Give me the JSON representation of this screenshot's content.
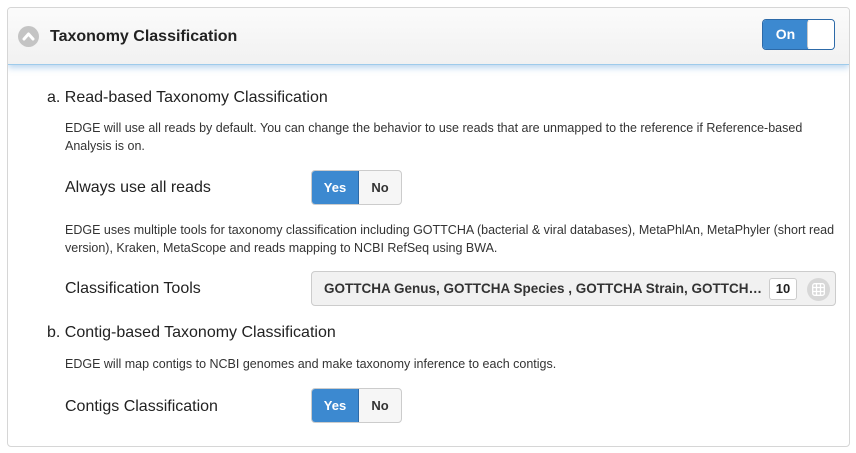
{
  "panel": {
    "title": "Taxonomy Classification",
    "toggle_label": "On"
  },
  "read_based": {
    "title": "a. Read-based Taxonomy Classification",
    "description": "EDGE will use all reads by default. You can change the behavior to use reads that are unmapped to the reference if Reference-based Analysis is on.",
    "always_use": {
      "label": "Always use all reads",
      "yes": "Yes",
      "no": "No",
      "selected": "Yes"
    },
    "tools_description": "EDGE uses multiple tools for taxonomy classification including GOTTCHA (bacterial & viral databases), MetaPhlAn, MetaPhyler (short read version), Kraken, MetaScope and reads mapping to NCBI RefSeq using BWA.",
    "classification_tools": {
      "label": "Classification Tools",
      "selected_text": "GOTTCHA Genus, GOTTCHA Species , GOTTCHA Strain, GOTTCHA Genus (viral), GOTTCHA Species (viral)",
      "count": "10",
      "icon": "grid-icon"
    }
  },
  "contig_based": {
    "title": "b. Contig-based Taxonomy Classification",
    "description": "EDGE will map contigs to NCBI genomes and make taxonomy inference to each contigs.",
    "contigs_classification": {
      "label": "Contigs Classification",
      "yes": "Yes",
      "no": "No",
      "selected": "Yes"
    }
  },
  "colors": {
    "accent": "#3c89d0",
    "header_glow": "#9ecbeb"
  }
}
